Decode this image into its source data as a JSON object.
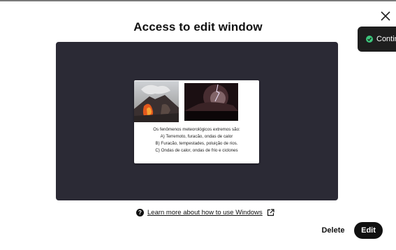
{
  "dialog": {
    "title": "Access to edit window",
    "close_icon": "close-icon"
  },
  "toast": {
    "icon": "check-circle-icon",
    "text": "Continue",
    "accent": "#3cc67c"
  },
  "slide": {
    "images": [
      "volcano-eruption-photo",
      "storm-lightning-photo"
    ],
    "lines": [
      "Os fenômenos meteorológicos extremos são:",
      "A) Terremoto, furacão, ondas de calor",
      "B) Furacão, tempestades, poluição de rios.",
      "C) Ondas de calor, ondas de frio e ciclones"
    ]
  },
  "help": {
    "icon": "help-icon",
    "link_text": "Learn more about how to use Windows",
    "external_icon": "external-link-icon"
  },
  "actions": {
    "delete_label": "Delete",
    "edit_label": "Edit"
  },
  "colors": {
    "preview_bg": "#2b2a35",
    "primary_button": "#111111"
  }
}
